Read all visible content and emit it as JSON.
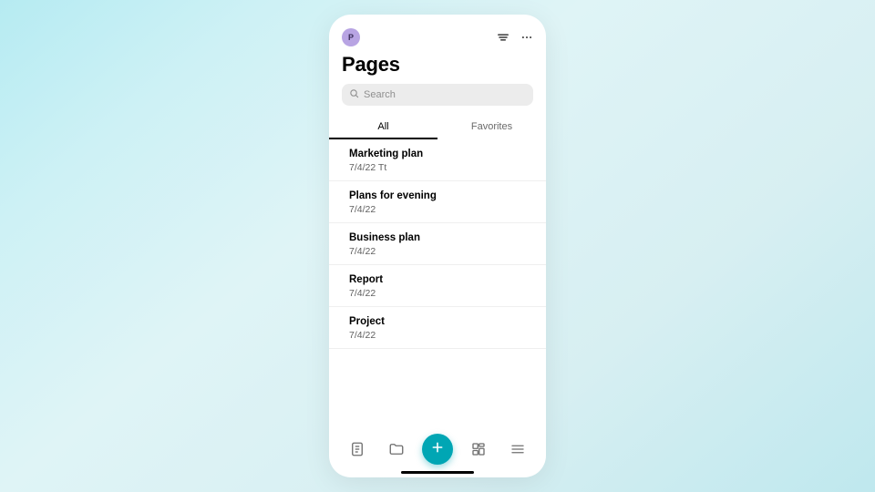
{
  "header": {
    "avatar_letter": "P",
    "title": "Pages"
  },
  "search": {
    "placeholder": "Search"
  },
  "tabs": {
    "all": "All",
    "favorites": "Favorites"
  },
  "items": [
    {
      "title": "Marketing plan",
      "sub": "7/4/22 Tt"
    },
    {
      "title": "Plans for evening",
      "sub": "7/4/22"
    },
    {
      "title": "Business plan",
      "sub": "7/4/22"
    },
    {
      "title": "Report",
      "sub": "7/4/22"
    },
    {
      "title": "Project",
      "sub": "7/4/22"
    }
  ],
  "colors": {
    "accent": "#00a6b4",
    "avatar": "#b8a4e3"
  }
}
